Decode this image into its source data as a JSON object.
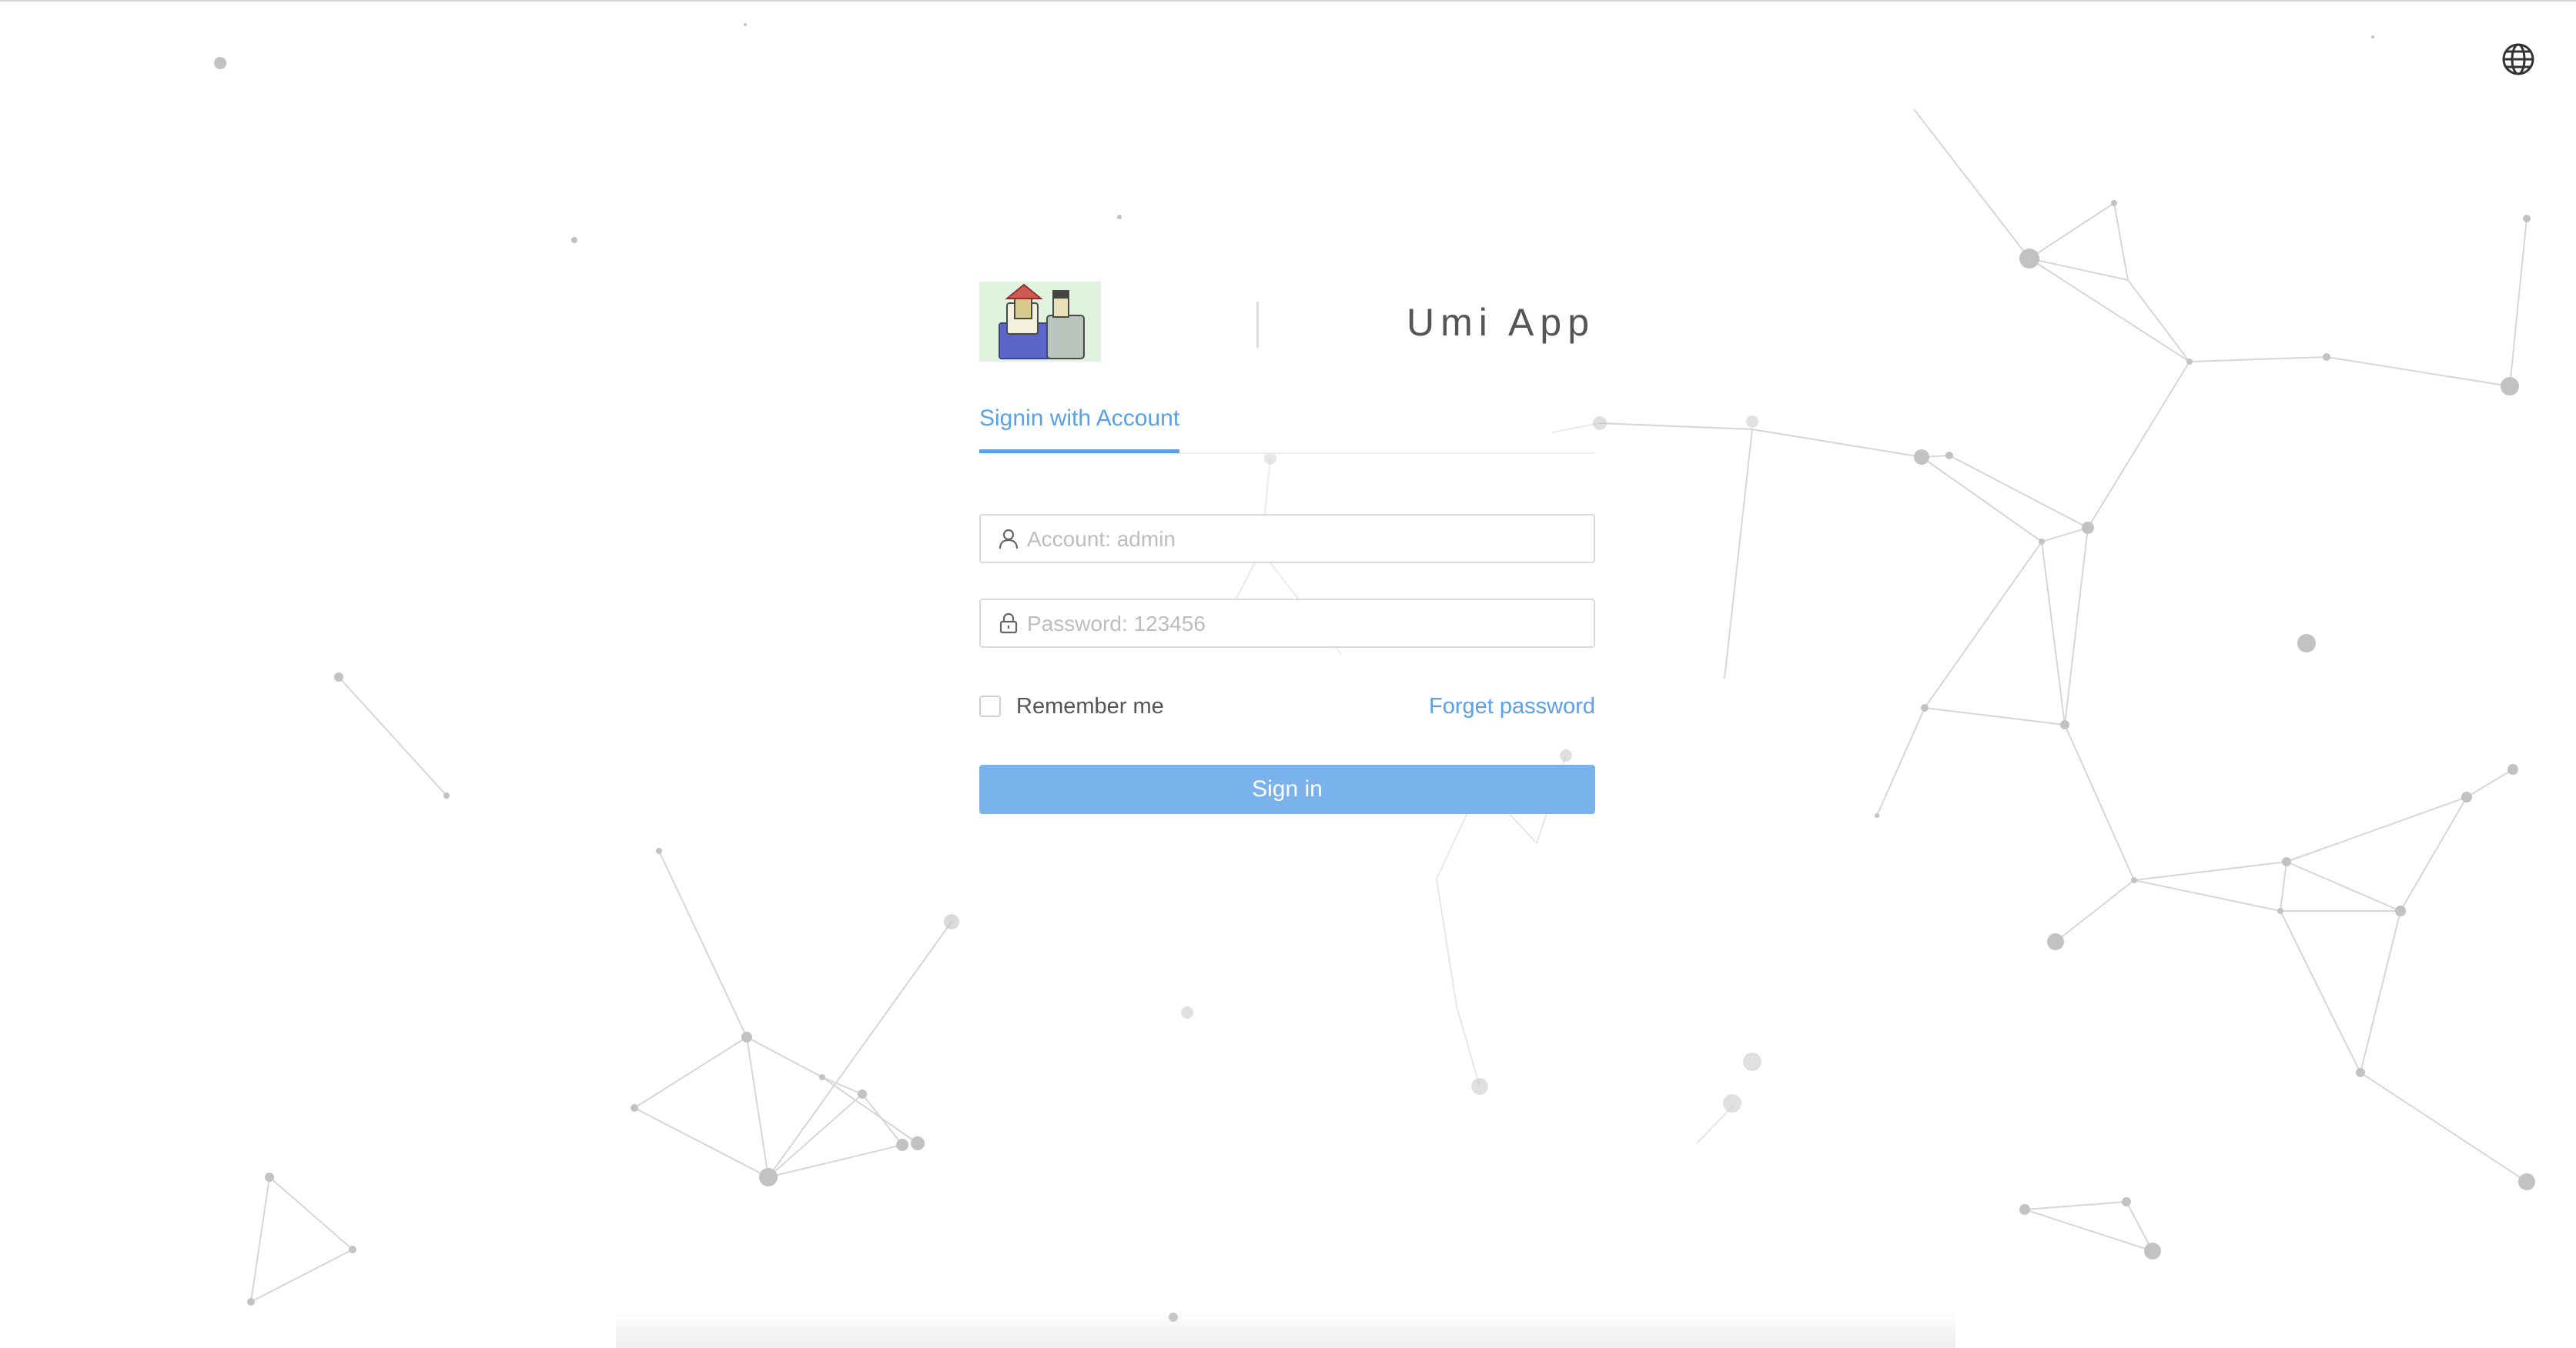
{
  "app": {
    "title": "Umi App",
    "logo_name": "umi-logo-icon"
  },
  "header": {
    "language_icon": "globe-icon"
  },
  "tabs": [
    {
      "label": "Signin with Account",
      "active": true
    }
  ],
  "form": {
    "account": {
      "placeholder": "Account: admin",
      "value": "",
      "icon": "user-icon"
    },
    "password": {
      "placeholder": "Password: 123456",
      "value": "",
      "icon": "lock-icon"
    },
    "remember_label": "Remember me",
    "remember_checked": false,
    "forget_label": "Forget password",
    "submit_label": "Sign in"
  },
  "colors": {
    "accent": "#5aa0e8",
    "button": "#7ab2ec",
    "title": "#555555",
    "network": "#b8b8b8"
  }
}
